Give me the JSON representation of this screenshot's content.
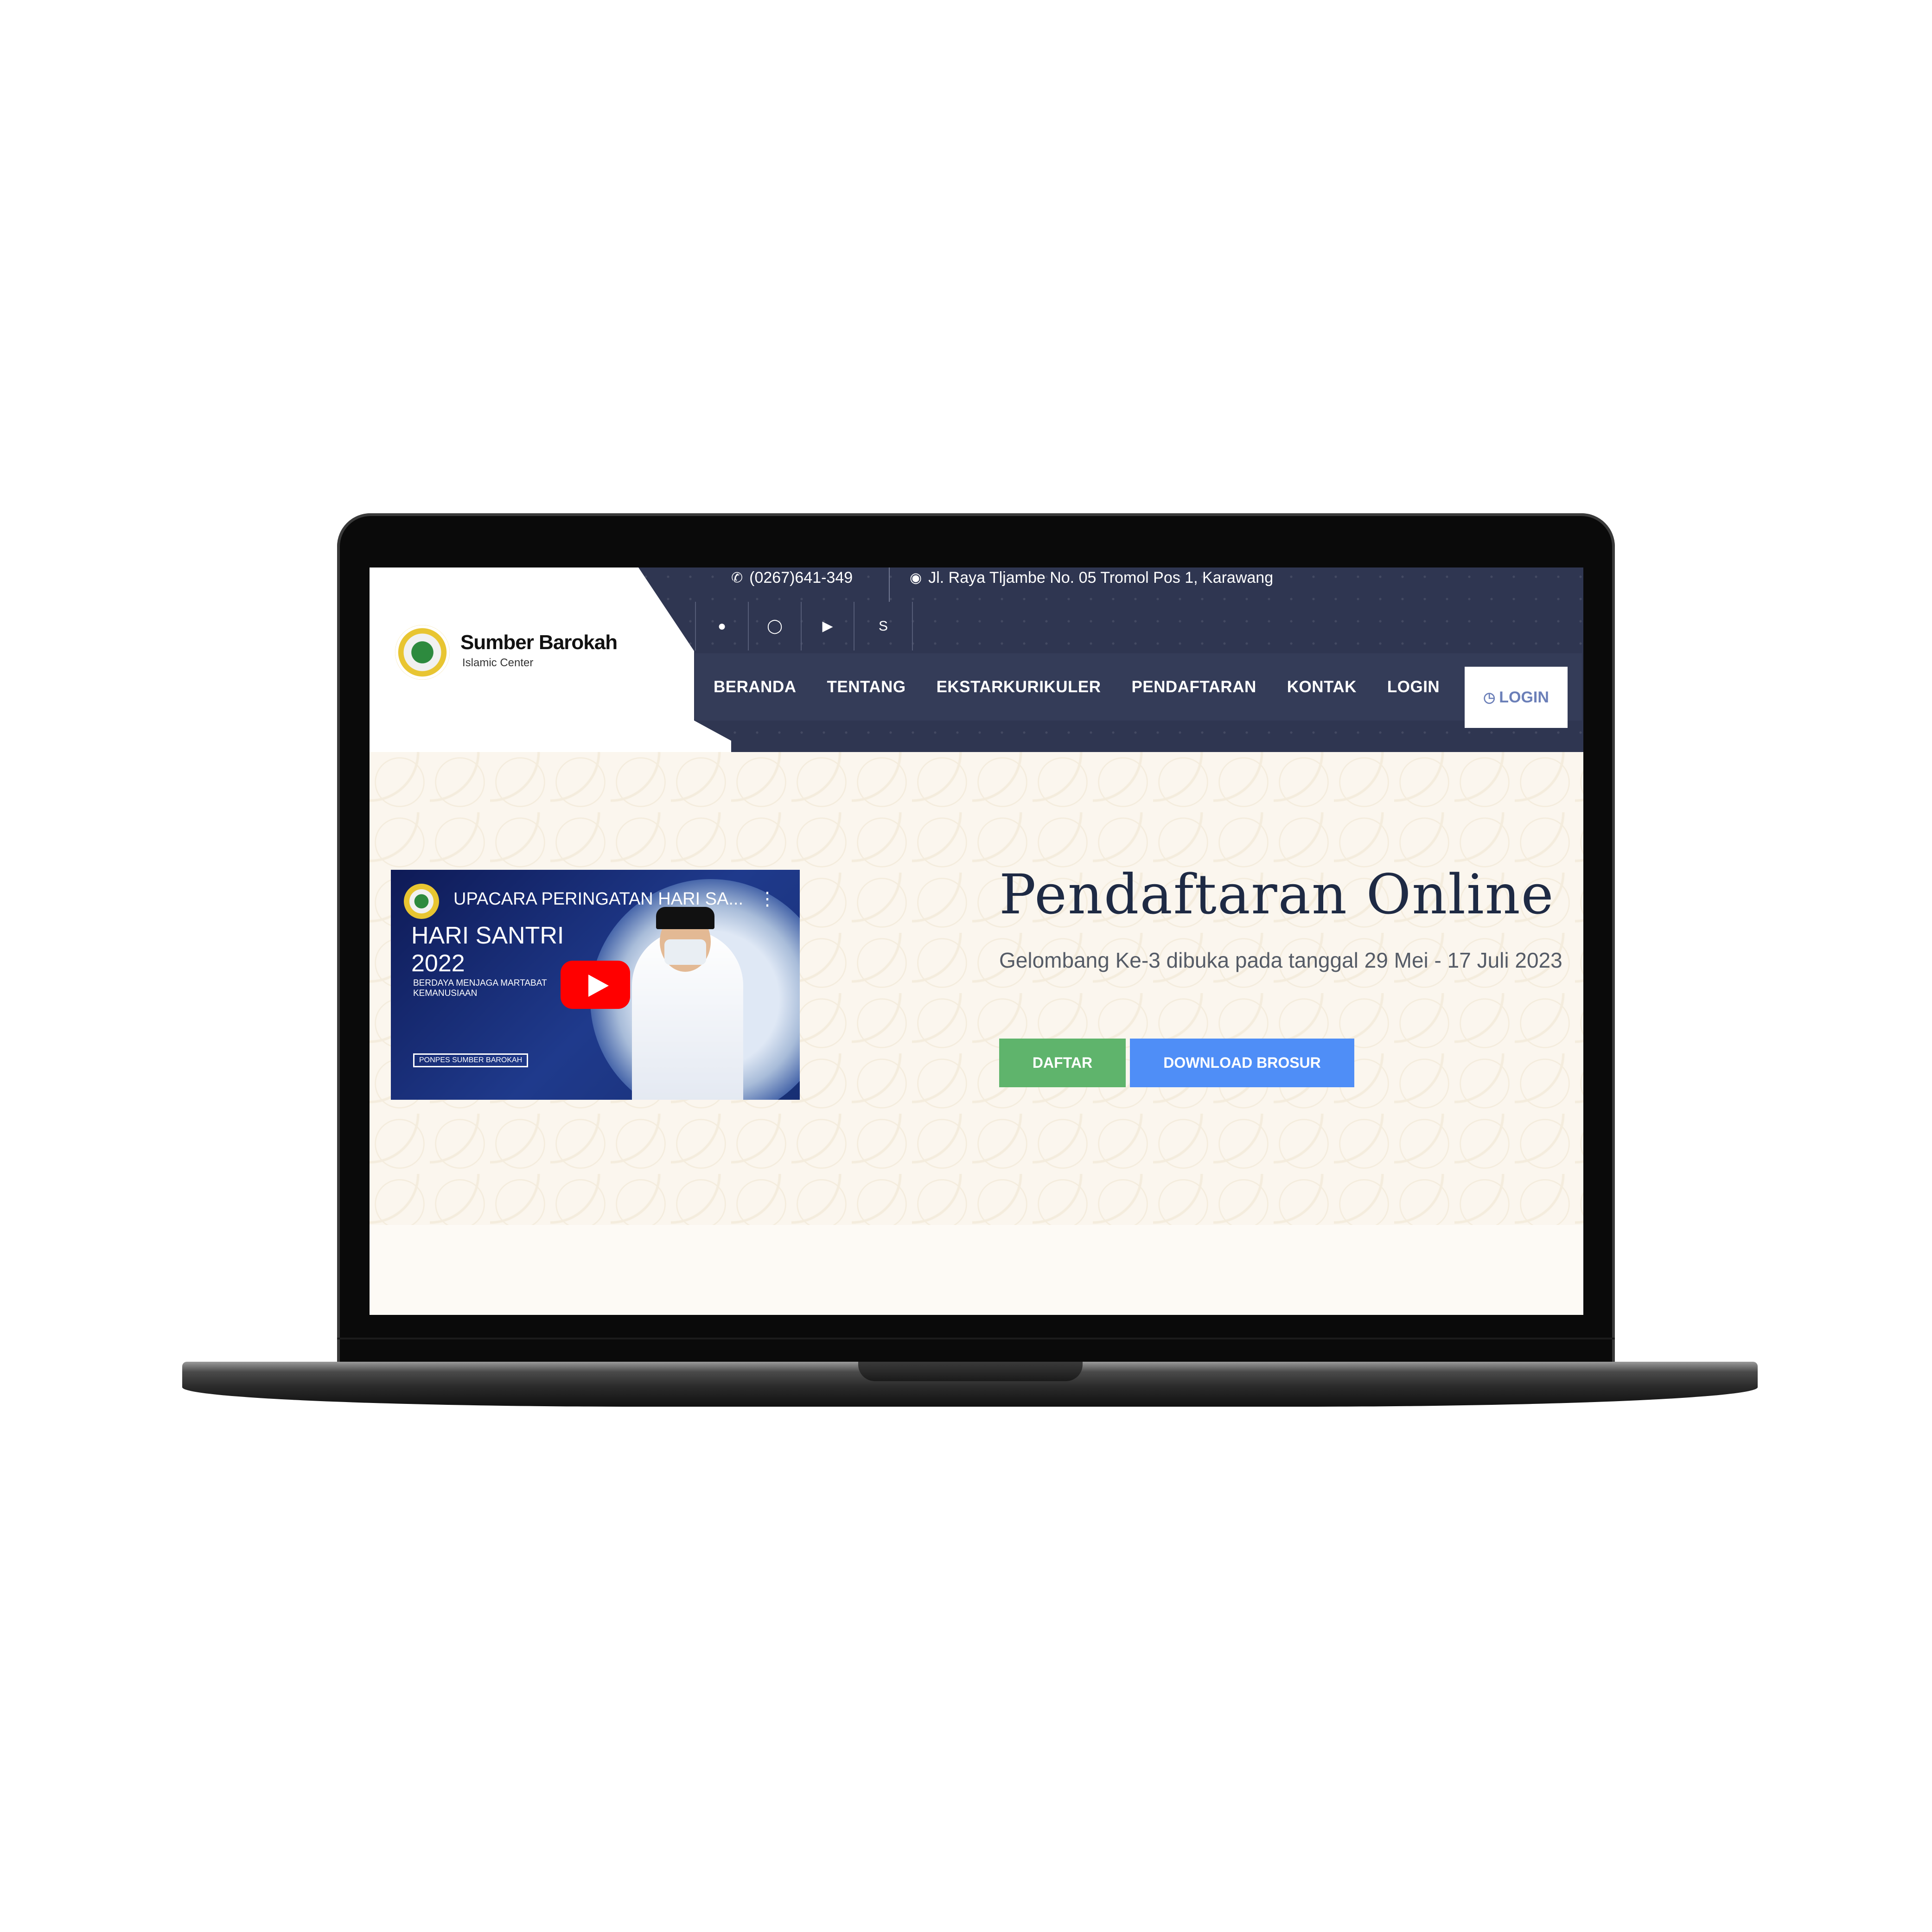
{
  "header": {
    "logo": {
      "title": "Sumber Barokah",
      "subtitle": "Islamic Center"
    },
    "topbar": {
      "phone_icon": "phone-icon",
      "phone": "(0267)641-349",
      "address_icon": "map-marker-icon",
      "address": "Jl. Raya Tljambe No. 05 Tromol Pos 1, Karawang"
    },
    "social": [
      "messenger-icon",
      "instagram-icon",
      "youtube-icon",
      "skype-icon"
    ],
    "nav": [
      "BERANDA",
      "TENTANG",
      "EKSTARKURIKULER",
      "PENDAFTARAN",
      "KONTAK",
      "LOGIN"
    ],
    "login_button": {
      "icon": "clock-icon",
      "label": "LOGIN"
    }
  },
  "hero": {
    "video": {
      "title": "UPACARA PERINGATAN HARI SA...",
      "thumb_heading_1": "HARI SANTRI",
      "thumb_heading_2": "2022",
      "thumb_tagline": "BERDAYA MENJAGA MARTABAT KEMANUSIAAN",
      "thumb_tag": "PONPES SUMBER BAROKAH"
    },
    "title": "Pendaftaran Online",
    "subtitle": "Gelombang Ke-3 dibuka pada tanggal 29 Mei - 17 Juli 2023",
    "buttons": {
      "daftar": "DAFTAR",
      "brosur": "DOWNLOAD BROSUR"
    }
  },
  "colors": {
    "header_bg": "#2f3651",
    "nav_bg": "#343c58",
    "daftar_btn": "#5fb46c",
    "brosur_btn": "#4f8ef7",
    "login_text": "#6b7fb8"
  }
}
